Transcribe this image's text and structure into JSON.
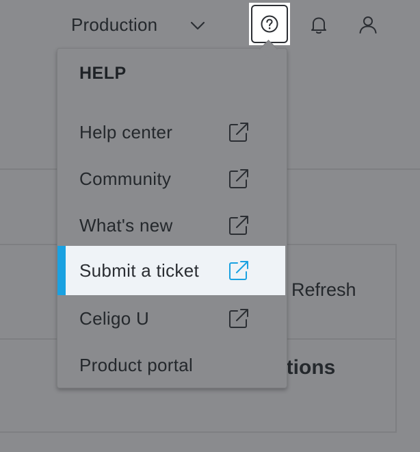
{
  "header": {
    "environment": "Production",
    "icons": {
      "chevron": "chevron-down-icon",
      "help": "help-circle-icon",
      "notifications": "bell-icon",
      "account": "user-icon"
    }
  },
  "background": {
    "refresh_label": "Refresh",
    "connections_label": "ctions"
  },
  "help_menu": {
    "title": "HELP",
    "items": [
      {
        "label": "Help center",
        "external": true
      },
      {
        "label": "Community",
        "external": true
      },
      {
        "label": "What's new",
        "external": true
      },
      {
        "label": "Submit a ticket",
        "external": true,
        "active": true
      },
      {
        "label": "Celigo U",
        "external": true
      },
      {
        "label": "Product portal",
        "external": false
      }
    ]
  },
  "colors": {
    "accent": "#1aa1e1",
    "overlay": "#8a8b8e",
    "active_bg": "#eff3f7",
    "text": "#24282c"
  }
}
